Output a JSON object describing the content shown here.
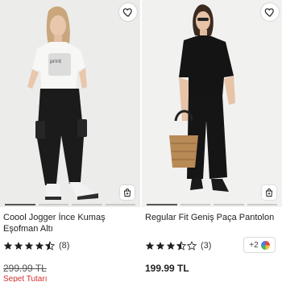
{
  "products": [
    {
      "title": "Coool Jogger İnce Kumaş Eşofman Altı",
      "rating_stars": 4.5,
      "review_count": "(8)",
      "old_price": "299.99 TL",
      "cart_total_label": "Sepet Tutarı",
      "image_icon": "product-photo"
    },
    {
      "title": "Regular Fit Geniş Paça Pantolon",
      "rating_stars": 3.5,
      "review_count": "(3)",
      "price": "199.99 TL",
      "more_colors": "+2",
      "image_icon": "product-photo"
    }
  ],
  "icons": {
    "favorite": "heart-icon",
    "add_to_cart": "shopping-bag-icon",
    "colors": "color-wheel-icon"
  },
  "colors": {
    "accent_red": "#d0302f",
    "star": "#1f1f1f"
  }
}
